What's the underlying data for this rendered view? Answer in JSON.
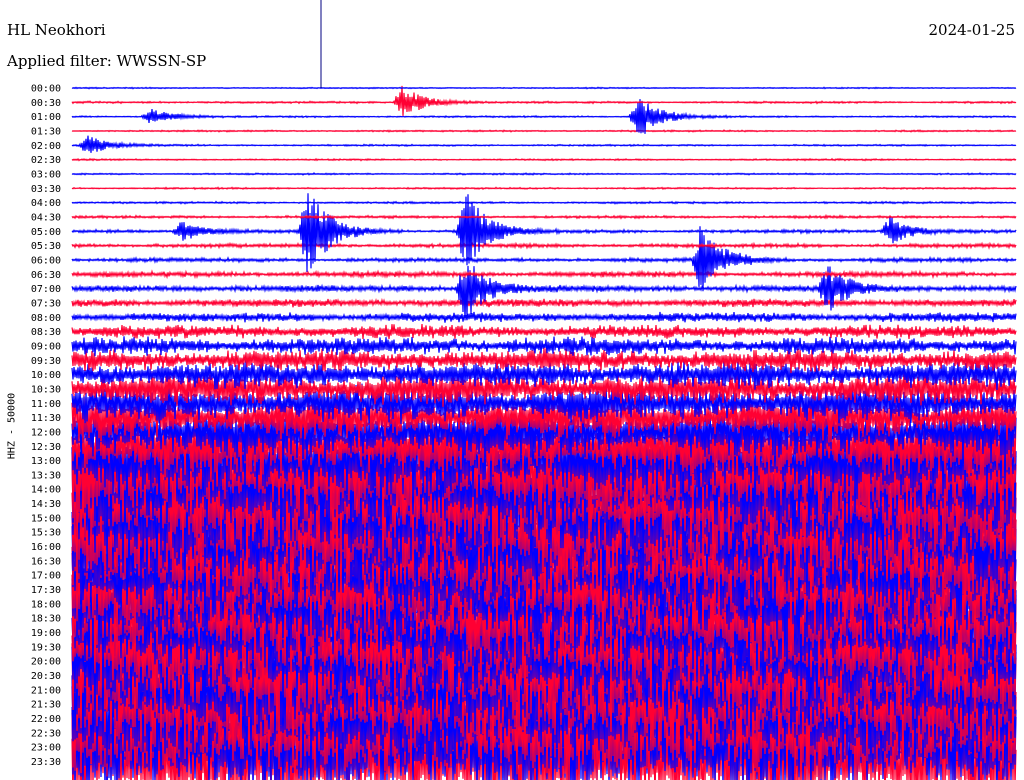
{
  "header": {
    "station": "HL Neokhori",
    "filter": "Applied filter: WWSSN-SP",
    "date": "2024-01-25"
  },
  "channel_label": "HHZ - 50000",
  "colors": {
    "blue": "#0000ff",
    "red": "#ff0033",
    "background": "#ffffff"
  },
  "chart_data": {
    "type": "line",
    "title": "HL Neokhori",
    "subtitle": "Applied filter: WWSSN-SP",
    "ylabel": "HHZ - 50000",
    "xlabel": "",
    "rows": [
      "00:00",
      "00:30",
      "01:00",
      "01:30",
      "02:00",
      "02:30",
      "03:00",
      "03:30",
      "04:00",
      "04:30",
      "05:00",
      "05:30",
      "06:00",
      "06:30",
      "07:00",
      "07:30",
      "08:00",
      "08:30",
      "09:00",
      "09:30",
      "10:00",
      "10:30",
      "11:00",
      "11:30",
      "12:00",
      "12:30",
      "13:00",
      "13:30",
      "14:00",
      "14:30",
      "15:00",
      "15:30",
      "16:00",
      "16:30",
      "17:00",
      "17:30",
      "18:00",
      "18:30",
      "19:00",
      "19:30",
      "20:00",
      "20:30",
      "21:00",
      "21:30",
      "22:00",
      "22:30",
      "23:00",
      "23:30"
    ],
    "row_colors": [
      "blue",
      "red"
    ],
    "noise_level": [
      0.04,
      0.06,
      0.05,
      0.05,
      0.05,
      0.05,
      0.05,
      0.05,
      0.06,
      0.08,
      0.1,
      0.12,
      0.12,
      0.16,
      0.2,
      0.24,
      0.3,
      0.42,
      0.55,
      0.7,
      0.85,
      1.0,
      1.2,
      1.4,
      1.7,
      2.0,
      2.4,
      2.8,
      3.0,
      3.2,
      3.2,
      3.1,
      3.0,
      3.0,
      2.9,
      2.9,
      2.8,
      2.8,
      2.8,
      2.9,
      3.0,
      3.0,
      3.0,
      3.1,
      3.1,
      3.1,
      3.2,
      3.2
    ],
    "events": [
      {
        "row": 1,
        "minute": 10.5,
        "amplitude": 1.6
      },
      {
        "row": 2,
        "minute": 18.0,
        "amplitude": 2.2
      },
      {
        "row": 2,
        "minute": 2.5,
        "amplitude": 0.8
      },
      {
        "row": 4,
        "minute": 0.5,
        "amplitude": 0.9
      },
      {
        "row": 10,
        "minute": 3.5,
        "amplitude": 1.0
      },
      {
        "row": 10,
        "minute": 7.5,
        "amplitude": 4.5
      },
      {
        "row": 10,
        "minute": 12.5,
        "amplitude": 4.0
      },
      {
        "row": 10,
        "minute": 26.0,
        "amplitude": 1.3
      },
      {
        "row": 12,
        "minute": 20.0,
        "amplitude": 3.5
      },
      {
        "row": 14,
        "minute": 12.5,
        "amplitude": 3.0
      },
      {
        "row": 14,
        "minute": 24.0,
        "amplitude": 2.2
      }
    ],
    "annotations": [],
    "grid": false,
    "legend": "none"
  }
}
